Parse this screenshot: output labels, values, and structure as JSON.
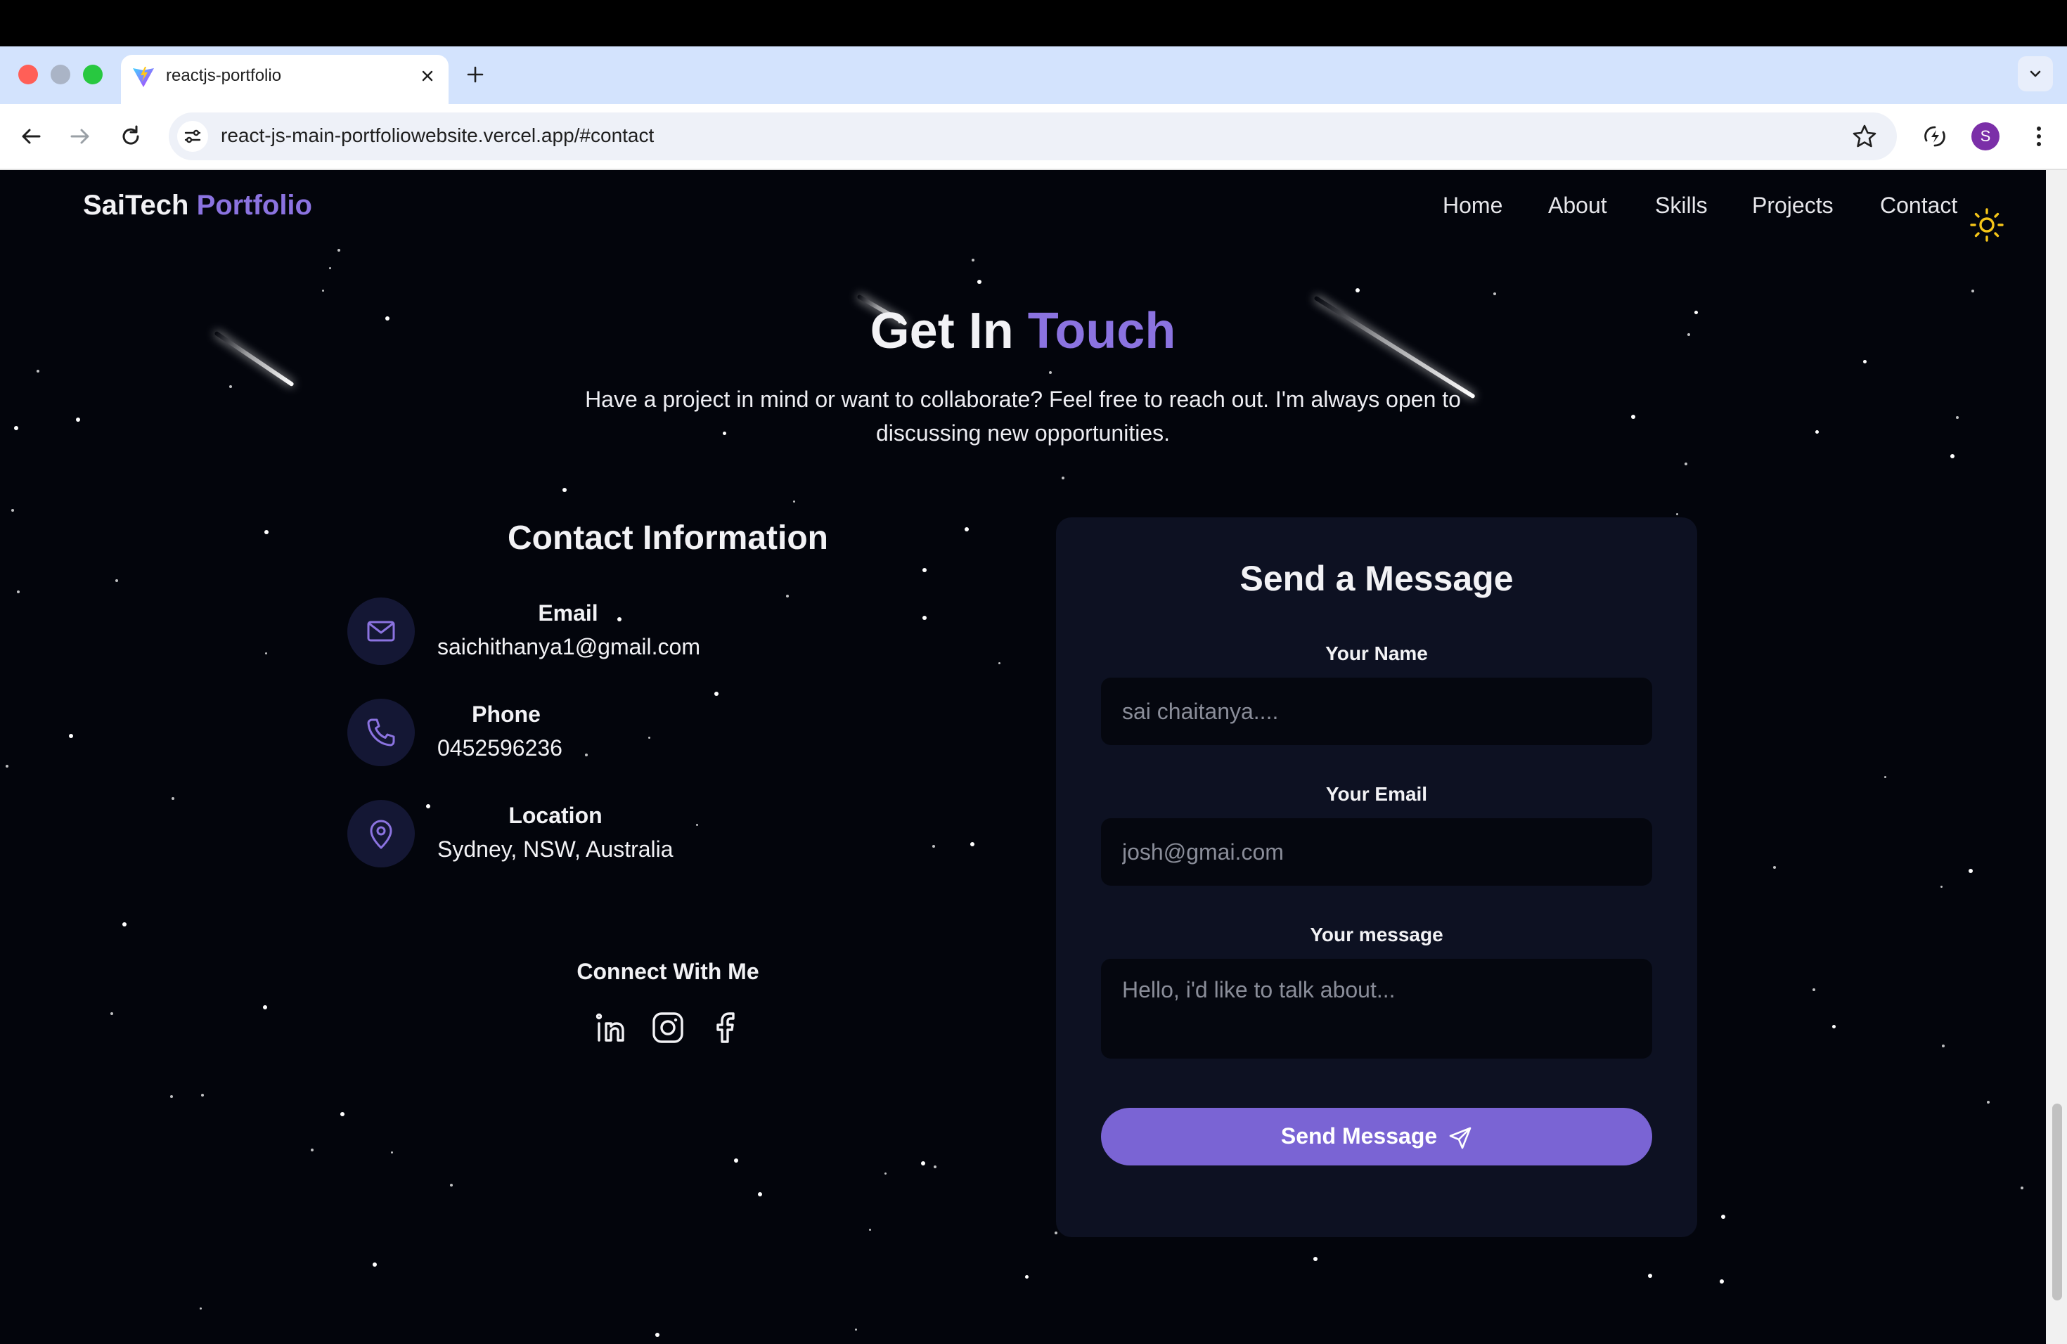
{
  "browser": {
    "tab_title": "reactjs-portfolio",
    "url": "react-js-main-portfoliowebsite.vercel.app/#contact",
    "profile_initial": "S"
  },
  "nav": {
    "brand_main": "SaiTech",
    "brand_accent": "Portfolio",
    "links": [
      "Home",
      "About",
      "Skills",
      "Projects",
      "Contact"
    ]
  },
  "hero": {
    "title_main": "Get In",
    "title_accent": "Touch",
    "subtitle": "Have a project in mind or want to collaborate? Feel free to reach out. I'm always open to discussing new opportunities."
  },
  "contact_info": {
    "title": "Contact Information",
    "items": [
      {
        "label": "Email",
        "value": "saichithanya1@gmail.com",
        "icon": "mail-icon"
      },
      {
        "label": "Phone",
        "value": "0452596236",
        "icon": "phone-icon"
      },
      {
        "label": "Location",
        "value": "Sydney, NSW, Australia",
        "icon": "map-pin-icon"
      }
    ],
    "connect_title": "Connect With Me",
    "socials": [
      "linkedin-icon",
      "instagram-icon",
      "facebook-icon"
    ]
  },
  "form": {
    "title": "Send a Message",
    "name_label": "Your Name",
    "name_placeholder": "sai chaitanya....",
    "email_label": "Your Email",
    "email_placeholder": "josh@gmai.com",
    "message_label": "Your message",
    "message_placeholder": "Hello, i'd like to talk about...",
    "submit_label": "Send Message"
  },
  "colors": {
    "accent": "#8b73e0",
    "button": "#7a64d4",
    "background": "#03050c",
    "card": "#0d1122"
  }
}
